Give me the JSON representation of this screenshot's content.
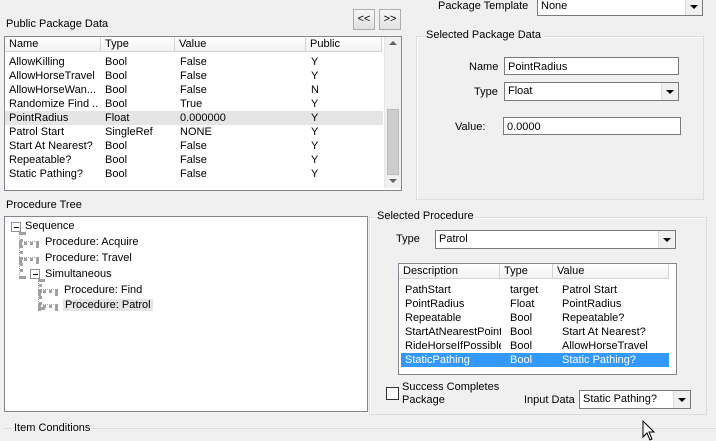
{
  "public_package": {
    "title": "Public Package Data",
    "nav_prev": "<<",
    "nav_next": ">>",
    "columns": [
      "Name",
      "Type",
      "Value",
      "Public"
    ],
    "rows": [
      {
        "name": "AllowKilling",
        "type": "Bool",
        "value": "False",
        "public": "Y"
      },
      {
        "name": "AllowHorseTravel",
        "type": "Bool",
        "value": "False",
        "public": "Y"
      },
      {
        "name": "AllowHorseWan...",
        "type": "Bool",
        "value": "False",
        "public": "N"
      },
      {
        "name": "Randomize Find ...",
        "type": "Bool",
        "value": "True",
        "public": "Y"
      },
      {
        "name": "PointRadius",
        "type": "Float",
        "value": "0.000000",
        "public": "Y"
      },
      {
        "name": "Patrol Start",
        "type": "SingleRef",
        "value": " NONE",
        "public": "Y"
      },
      {
        "name": "Start At Nearest?",
        "type": "Bool",
        "value": "False",
        "public": "Y"
      },
      {
        "name": "Repeatable?",
        "type": "Bool",
        "value": "False",
        "public": "Y"
      },
      {
        "name": "Static Pathing?",
        "type": "Bool",
        "value": "False",
        "public": "Y"
      }
    ]
  },
  "package_template": {
    "label": "Package Template",
    "value": "None"
  },
  "selected_package": {
    "title": "Selected Package Data",
    "name_label": "Name",
    "name_value": "PointRadius",
    "type_label": "Type",
    "type_value": "Float",
    "value_label": "Value:",
    "value_value": "0.0000"
  },
  "procedure_tree": {
    "title": "Procedure Tree",
    "nodes": [
      "Sequence",
      "Procedure: Acquire",
      "Procedure: Travel",
      "Simultaneous",
      "Procedure: Find",
      "Procedure: Patrol"
    ]
  },
  "selected_procedure": {
    "title": "Selected Procedure",
    "type_label": "Type",
    "type_value": "Patrol",
    "columns": [
      "Description",
      "Type",
      "Value"
    ],
    "rows": [
      {
        "description": "PathStart",
        "type": "target",
        "value": "Patrol Start"
      },
      {
        "description": "PointRadius",
        "type": "Float",
        "value": "PointRadius"
      },
      {
        "description": "Repeatable",
        "type": "Bool",
        "value": "Repeatable?"
      },
      {
        "description": "StartAtNearestPoint",
        "type": "Bool",
        "value": "Start At Nearest?"
      },
      {
        "description": "RideHorseIfPossible",
        "type": "Bool",
        "value": "AllowHorseTravel"
      },
      {
        "description": "StaticPathing",
        "type": "Bool",
        "value": "Static Pathing?"
      }
    ],
    "success_line1": "Success Completes",
    "success_line2": "Package",
    "input_label": "Input Data",
    "input_value": "Static Pathing?"
  },
  "item_conditions": {
    "title": "Item Conditions"
  },
  "colors": {
    "selection": "#3399ff",
    "highlight_row": "#e5e5e5"
  }
}
